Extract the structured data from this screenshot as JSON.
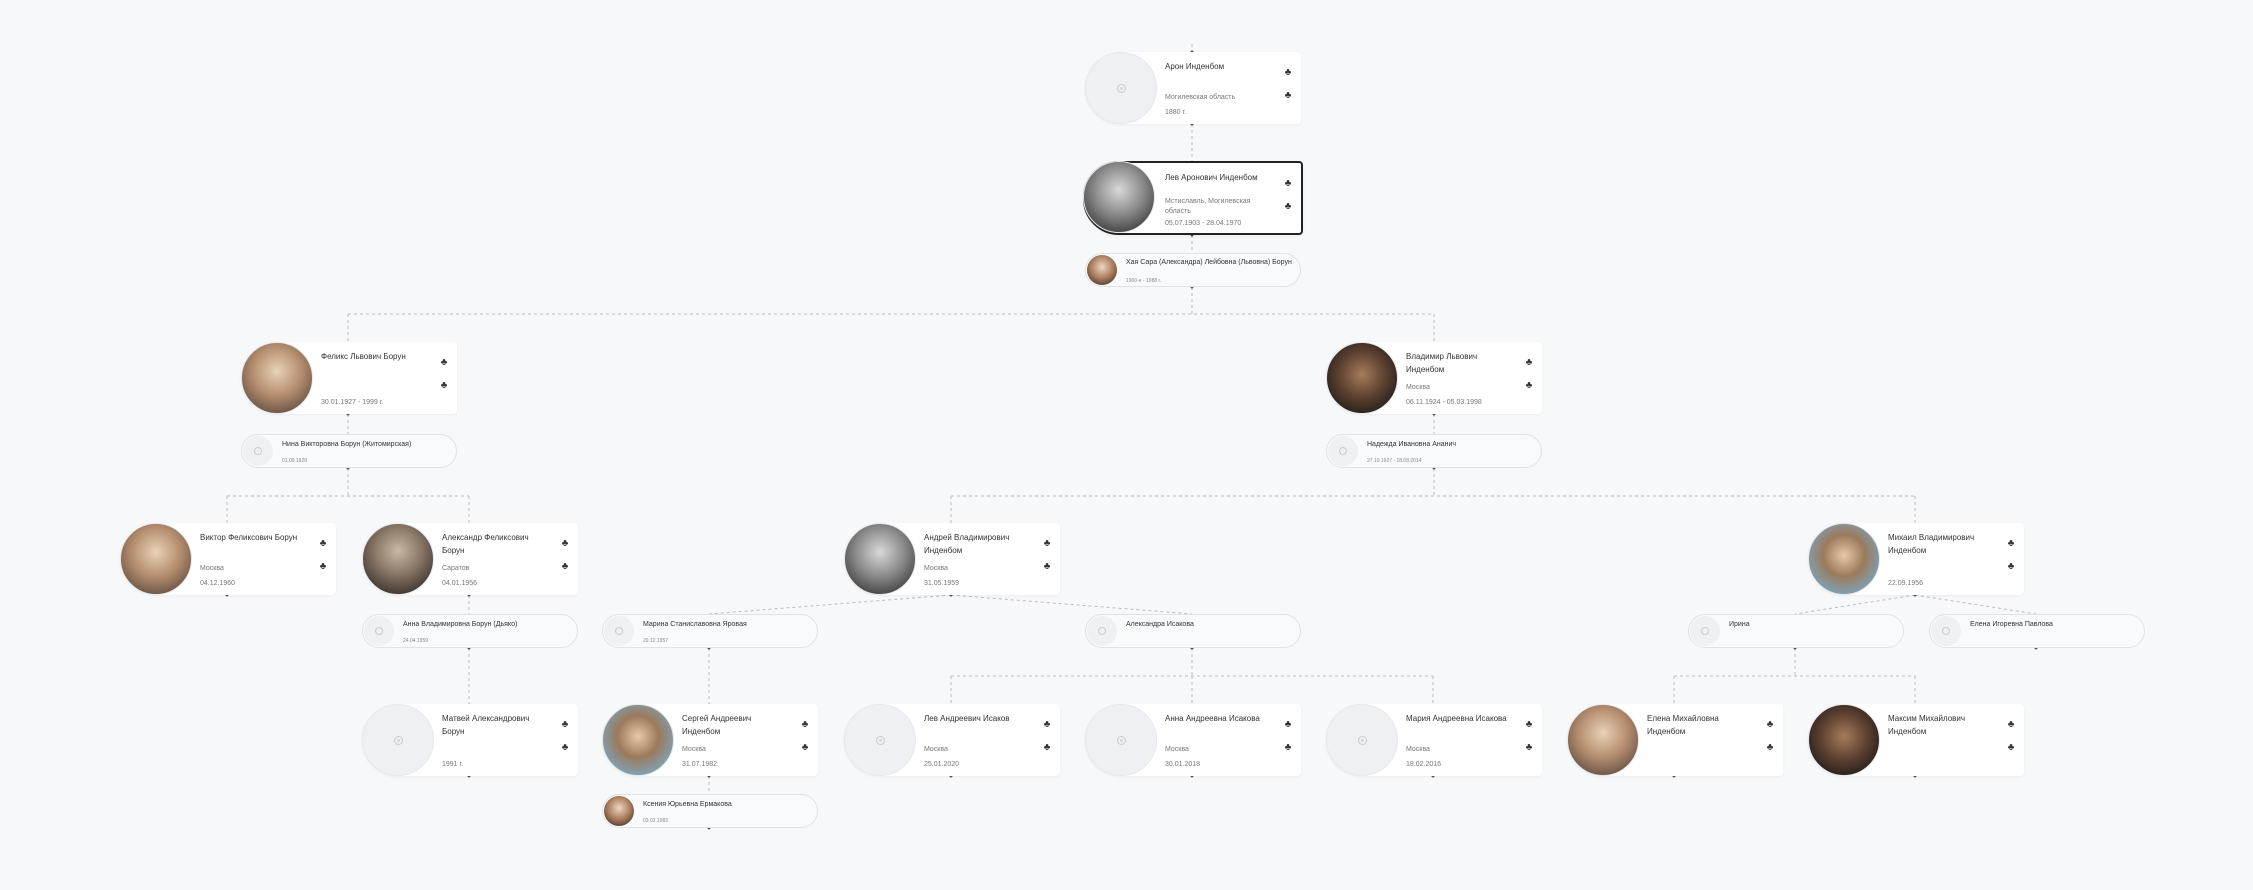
{
  "colors": {
    "background": "#f7f8fa",
    "card": "#ffffff",
    "connector": "#b7bcc4",
    "selected_border": "#222222"
  },
  "icons": {
    "tree": "family-tree-icon",
    "placeholder": "empty-avatar-icon"
  },
  "persons": {
    "aron": {
      "name": "Арон Инденбом",
      "place": "Могилевская область",
      "dates": "1880 г.",
      "photo": false
    },
    "lev": {
      "name": "Лев Аронович Инденбом",
      "place": "Мстиславль, Могилевская область",
      "dates": "05.07.1903 - 28.04.1970",
      "photo": true
    },
    "felix": {
      "name": "Феликс Львович Борун",
      "place": "",
      "dates": "30.01.1927 - 1999 г.",
      "photo": true
    },
    "vladimir": {
      "name": "Владимир Львович Инденбом",
      "place": "Москва",
      "dates": "06.11.1924 - 05.03.1998",
      "photo": true
    },
    "viktor": {
      "name": "Виктор Феликсович Борун",
      "place": "Москва",
      "dates": "04.12.1960",
      "photo": true
    },
    "aleksandr": {
      "name": "Александр Феликсович Борун",
      "place": "Саратов",
      "dates": "04.01.1956",
      "photo": true
    },
    "andrey": {
      "name": "Андрей Владимирович Инденбом",
      "place": "Москва",
      "dates": "31.05.1959",
      "photo": true
    },
    "mikhail": {
      "name": "Михаил Владимирович Инденбом",
      "place": "",
      "dates": "22.09.1956",
      "photo": true
    },
    "matvey": {
      "name": "Матвей Александрович Борун",
      "place": "",
      "dates": "1991 г.",
      "photo": false
    },
    "sergey": {
      "name": "Сергей Андреевич Инденбом",
      "place": "Москва",
      "dates": "31.07.1982",
      "photo": true
    },
    "lev_i": {
      "name": "Лев Андреевич Исаков",
      "place": "Москва",
      "dates": "25.01.2020",
      "photo": false
    },
    "anna_i": {
      "name": "Анна Андреевна Исакова",
      "place": "Москва",
      "dates": "30.01.2018",
      "photo": false
    },
    "maria_i": {
      "name": "Мария Андреевна Исакова",
      "place": "Москва",
      "dates": "18.02.2016",
      "photo": false
    },
    "elena_m": {
      "name": "Елена Михайловна Инденбом",
      "place": "",
      "dates": "",
      "photo": true
    },
    "maksim": {
      "name": "Максим Михайлович Инденбом",
      "place": "",
      "dates": "",
      "photo": true
    }
  },
  "spouses": {
    "khaya": {
      "name": "Хая Сара (Александра) Лейбовна (Львовна) Борун",
      "dates": "1900-е - 1988 г.",
      "photo": true
    },
    "nina": {
      "name": "Нина Викторовна Борун (Житомирская)",
      "dates": "01.09.1928",
      "photo": false
    },
    "nadezhda": {
      "name": "Надежда Ивановна Ананич",
      "dates": "27.10.1927 - 18.08.2014",
      "photo": false
    },
    "anna_d": {
      "name": "Анна Владимировна Борун (Дьяко)",
      "dates": "24.04.1959",
      "photo": false
    },
    "marina": {
      "name": "Марина Станиславовна Яровая",
      "dates": "29.12.1957",
      "photo": false
    },
    "aleksandra": {
      "name": "Александра Исакова",
      "dates": "",
      "photo": false
    },
    "irina": {
      "name": "Ирина",
      "dates": "",
      "photo": false
    },
    "elena_p": {
      "name": "Елена Игоревна Павлова",
      "dates": "",
      "photo": false
    },
    "kseniya": {
      "name": "Ксения Юрьевна Ермакова",
      "dates": "03.02.1983",
      "photo": true
    }
  }
}
